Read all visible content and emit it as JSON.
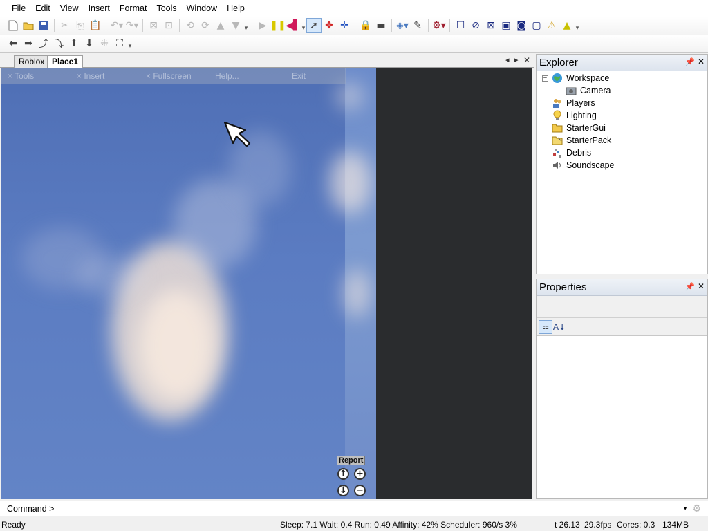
{
  "menu": [
    "File",
    "Edit",
    "View",
    "Insert",
    "Format",
    "Tools",
    "Window",
    "Help"
  ],
  "toolbar_icons": {
    "row1": [
      "new-icon",
      "open-icon",
      "save-icon",
      "cut-icon",
      "copy-icon",
      "paste-icon",
      "undo-icon",
      "redo-icon",
      "group-icon",
      "ungroup-icon",
      "rotate-left-icon",
      "rotate-right-icon",
      "up-icon",
      "down-icon",
      "play-icon",
      "pause-icon",
      "reset-icon",
      "select-icon",
      "move-icon",
      "resize-icon",
      "lock-icon",
      "anchor-icon",
      "paint-icon",
      "dropper-icon",
      "axis-icon",
      "surface-icon"
    ],
    "row2": [
      "left-arrow-icon",
      "right-arrow-icon",
      "curve-up-icon",
      "curve-down-icon",
      "up-arrow-icon",
      "down-arrow-icon",
      "fit-icon",
      "fullscreen-icon"
    ]
  },
  "doc_tabs": [
    "Roblox",
    "Place1"
  ],
  "viewport": {
    "overlay_menu": [
      "Tools",
      "Insert",
      "Fullscreen",
      "Help...",
      "Exit"
    ],
    "report_label": "Report",
    "cam_buttons": [
      "↑",
      "+",
      "↓",
      "−"
    ]
  },
  "explorer": {
    "title": "Explorer",
    "items": [
      "Workspace",
      "Camera",
      "Players",
      "Lighting",
      "StarterGui",
      "StarterPack",
      "Debris",
      "Soundscape"
    ]
  },
  "properties": {
    "title": "Properties"
  },
  "command": {
    "label": "Command >",
    "value": ""
  },
  "status": {
    "ready": "Ready",
    "stats": "Sleep: 7.1 Wait: 0.4 Run: 0.49 Affinity: 42% Scheduler: 960/s 3%",
    "time": "t 26.13",
    "fps": "29.3fps",
    "cores": "Cores: 0.3",
    "memory": "134MB"
  },
  "colors": {
    "sky_top": "#4f6fb5",
    "viewport_dark": "#2a2c2e",
    "active_tool": "#d6e8fb"
  }
}
